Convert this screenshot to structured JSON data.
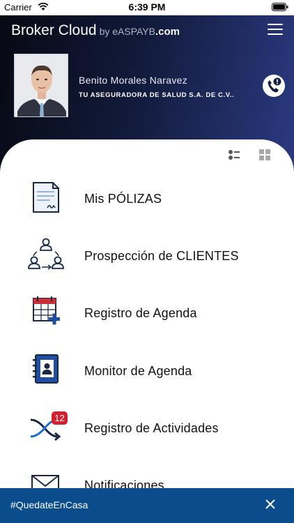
{
  "status_bar": {
    "carrier": "Carrier",
    "time": "6:39 PM"
  },
  "header": {
    "brand_main": "Broker Cloud",
    "brand_by": "by eASPAYB",
    "brand_domain": ".com",
    "menu_icon": "hamburger-icon"
  },
  "profile": {
    "name": "Benito Morales Naravez",
    "company": "TU ASEGURADORA DE SALUD S.A. DE C.V..",
    "call_icon": "phone-alert-icon"
  },
  "view_toggles": {
    "list_icon": "list-view-icon",
    "grid_icon": "grid-view-icon"
  },
  "menu": {
    "items": [
      {
        "label": "Mis PÓLIZAS",
        "icon": "policy-document-icon"
      },
      {
        "label": "Prospección de CLIENTES",
        "icon": "people-cycle-icon"
      },
      {
        "label": "Registro de Agenda",
        "icon": "calendar-add-icon"
      },
      {
        "label": "Monitor de Agenda",
        "icon": "address-book-icon"
      },
      {
        "label": "Registro de Actividades",
        "icon": "shuffle-arrows-icon",
        "badge": "12"
      },
      {
        "label": "Notificaciones",
        "icon": "envelope-icon"
      }
    ]
  },
  "banner": {
    "text": "#QuedateEnCasa",
    "close_icon": "close-icon"
  },
  "colors": {
    "header_dark": "#070912",
    "header_accent": "#2c3a82",
    "banner": "#0a4c8c",
    "badge": "#d32030"
  }
}
